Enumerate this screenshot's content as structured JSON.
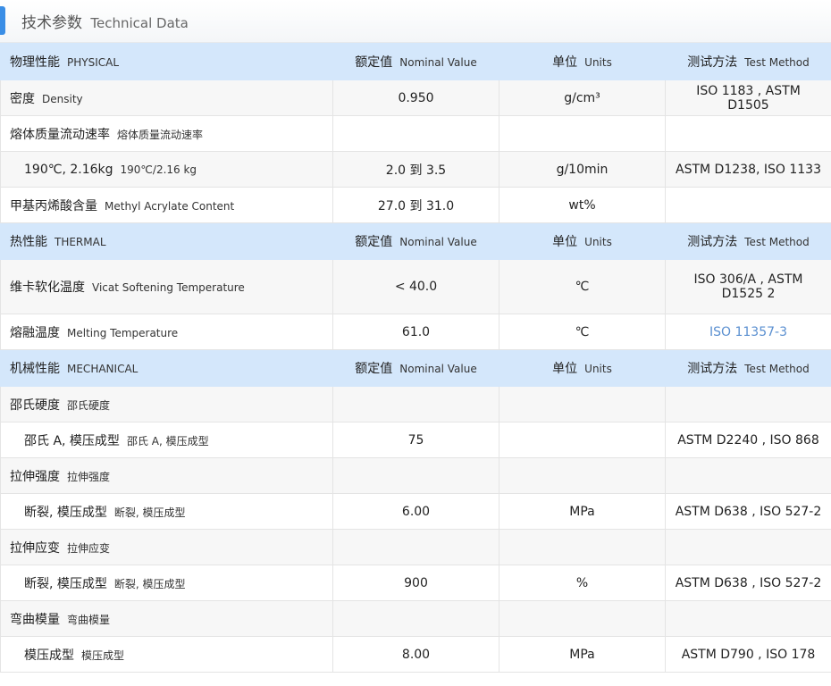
{
  "header": {
    "title_cn": "技术参数",
    "title_en": "Technical Data"
  },
  "sections": [
    {
      "header": {
        "cn": "物理性能",
        "en": "PHYSICAL",
        "value_cn": "额定值",
        "value_en": "Nominal Value",
        "units_cn": "单位",
        "units_en": "Units",
        "method_cn": "测试方法",
        "method_en": "Test Method"
      },
      "rows": [
        {
          "cn": "密度",
          "en": "Density",
          "value": "0.950",
          "units": "g/cm³",
          "method": "ISO 1183 , ASTM D1505"
        },
        {
          "cn": "熔体质量流动速率",
          "en": "熔体质量流动速率",
          "value": "",
          "units": "",
          "method": ""
        },
        {
          "cn": "190℃, 2.16kg",
          "en": "190℃/2.16 kg",
          "value": "2.0 到 3.5",
          "units": "g/10min",
          "method": "ASTM D1238, ISO 1133"
        },
        {
          "cn": "甲基丙烯酸含量",
          "en": "Methyl Acrylate Content",
          "value": "27.0 到 31.0",
          "units": "wt%",
          "method": ""
        }
      ]
    },
    {
      "header": {
        "cn": "热性能",
        "en": "THERMAL",
        "value_cn": "额定值",
        "value_en": "Nominal Value",
        "units_cn": "单位",
        "units_en": "Units",
        "method_cn": "测试方法",
        "method_en": "Test Method"
      },
      "rows": [
        {
          "cn": "维卡软化温度",
          "en": "Vicat Softening Temperature",
          "value": "< 40.0",
          "units": "℃",
          "method": "ISO 306/A , ASTM D1525 2"
        },
        {
          "cn": "熔融温度",
          "en": "Melting Temperature",
          "value": "61.0",
          "units": "℃",
          "method": "ISO 11357-3"
        }
      ]
    },
    {
      "header": {
        "cn": "机械性能",
        "en": "MECHANICAL",
        "value_cn": "额定值",
        "value_en": "Nominal Value",
        "units_cn": "单位",
        "units_en": "Units",
        "method_cn": "测试方法",
        "method_en": "Test Method"
      },
      "rows": [
        {
          "cn": "邵氏硬度",
          "en": "邵氏硬度",
          "value": "",
          "units": "",
          "method": ""
        },
        {
          "cn": "邵氏 A, 模压成型",
          "en": "邵氏 A, 模压成型",
          "value": "75",
          "units": "",
          "method": "ASTM D2240 , ISO 868"
        },
        {
          "cn": "拉伸强度",
          "en": "拉伸强度",
          "value": "",
          "units": "",
          "method": ""
        },
        {
          "cn": "断裂, 模压成型",
          "en": "断裂, 模压成型",
          "value": "6.00",
          "units": "MPa",
          "method": "ASTM D638 , ISO 527-2"
        },
        {
          "cn": "拉伸应变",
          "en": "拉伸应变",
          "value": "",
          "units": "",
          "method": ""
        },
        {
          "cn": "断裂, 模压成型",
          "en": "断裂, 模压成型",
          "value": "900",
          "units": "%",
          "method": "ASTM D638 , ISO 527-2"
        },
        {
          "cn": "弯曲模量",
          "en": "弯曲模量",
          "value": "",
          "units": "",
          "method": ""
        },
        {
          "cn": "模压成型",
          "en": "模压成型",
          "value": "8.00",
          "units": "MPa",
          "method": "ASTM D790 , ISO 178"
        }
      ]
    }
  ]
}
